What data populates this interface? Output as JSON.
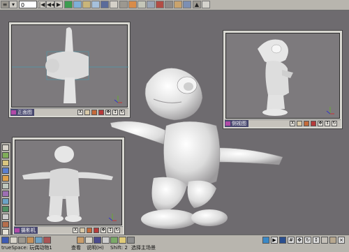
{
  "toolbar": {
    "frame_value": "0",
    "buttons": [
      "|◀",
      "◀◀",
      "▶",
      "▶▶",
      "▶|"
    ]
  },
  "viewports": {
    "front": {
      "label": "正面图",
      "close": "X"
    },
    "side": {
      "label": "侧视图",
      "close": "X"
    },
    "camera": {
      "label": "摄影机",
      "close": "X"
    }
  },
  "status": {
    "app": "trueSpace: 玩偶动物1",
    "menu1": "查看",
    "menu2": "说明(H)",
    "hint": "Shift: 2",
    "message": "选择主场景"
  },
  "colors": {
    "background": "#6e6b6f",
    "panel": "#b8b5ae",
    "label_bar": "#47476e",
    "model": "#e8e8e8"
  }
}
